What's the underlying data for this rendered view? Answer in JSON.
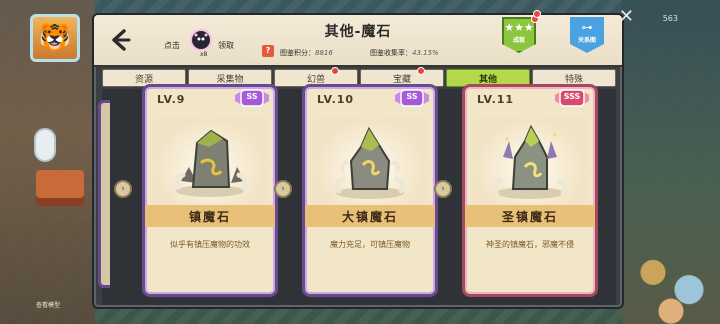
{
  "header": {
    "title": "其他-魔石",
    "tap_label": "点击",
    "claim_label": "领取",
    "creature_count": "x8",
    "score_label": "图鉴积分：",
    "score_value": "8816",
    "rate_label": "图鉴收集率：",
    "rate_value": "43.15%",
    "help_symbol": "?",
    "achievement_label": "成就",
    "graph_label": "关系图"
  },
  "tabs": [
    {
      "label": "资源",
      "active": false,
      "dot": false
    },
    {
      "label": "采集物",
      "active": false,
      "dot": false
    },
    {
      "label": "幻兽",
      "active": false,
      "dot": true
    },
    {
      "label": "宝藏",
      "active": false,
      "dot": true
    },
    {
      "label": "其他",
      "active": true,
      "dot": false
    },
    {
      "label": "特殊",
      "active": false,
      "dot": false
    }
  ],
  "cards": [
    {
      "level": "LV.9",
      "rank": "SS",
      "name": "镇魔石",
      "desc": "似乎有镇压魔物的功效"
    },
    {
      "level": "LV.10",
      "rank": "SS",
      "name": "大镇魔石",
      "desc": "魔力充足，可镇压魔物"
    },
    {
      "level": "LV.11",
      "rank": "SSS",
      "name": "圣镇魔石",
      "desc": "神圣的镇魔石，邪魔不侵"
    }
  ],
  "background": {
    "bottom_left_text": "查看模型",
    "right_top_number": "563"
  },
  "colors": {
    "active_tab": "#b5d84a",
    "card_border_purple": "#6a4a8e",
    "card_border_pink": "#a34a5f",
    "name_bar": "#e8c07a",
    "rank_ss": "#a65ad9",
    "rank_sss": "#d94a6a"
  }
}
